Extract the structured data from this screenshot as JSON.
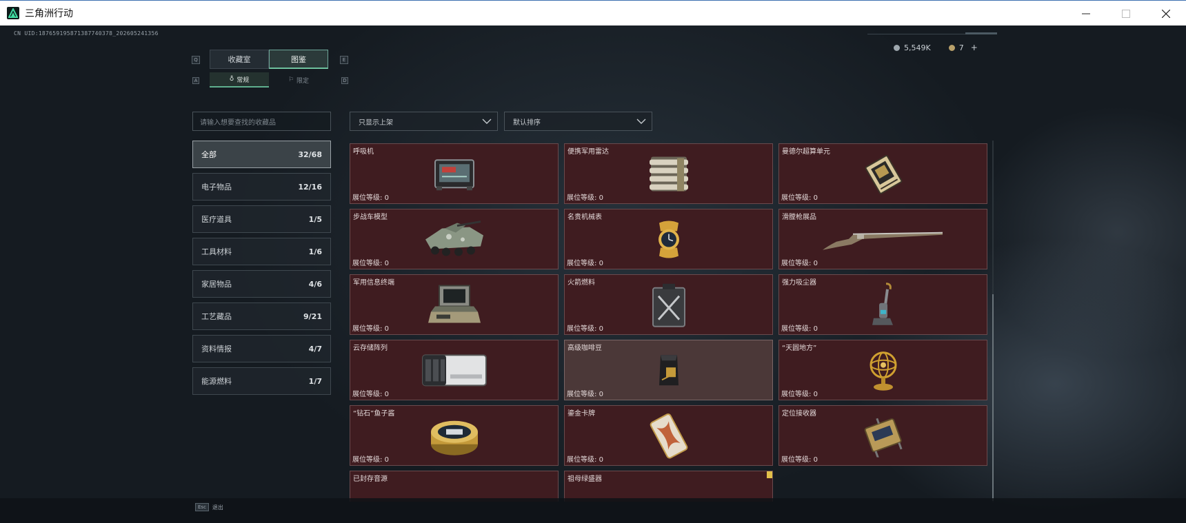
{
  "window": {
    "title": "三角洲行动"
  },
  "header": {
    "uid": "CN UID:18765919587138774037​8_202605241356",
    "silver": "5,549K",
    "gold": "7",
    "add": "+"
  },
  "keys": {
    "q": "Q",
    "e": "E",
    "a": "A",
    "d": "D",
    "esc": "Esc"
  },
  "tabs": {
    "main": [
      {
        "label": "收藏室"
      },
      {
        "label": "图鉴"
      }
    ],
    "sub": [
      {
        "label": "常规"
      },
      {
        "label": "限定"
      }
    ]
  },
  "search": {
    "placeholder": "请输入想要查找的收藏品"
  },
  "filters": {
    "show": "只显示上架",
    "sort": "默认排序"
  },
  "categories": [
    {
      "name": "全部",
      "count": "32/68"
    },
    {
      "name": "电子物品",
      "count": "12/16"
    },
    {
      "name": "医疗道具",
      "count": "1/5"
    },
    {
      "name": "工具材料",
      "count": "1/6"
    },
    {
      "name": "家居物品",
      "count": "4/6"
    },
    {
      "name": "工艺藏品",
      "count": "9/21"
    },
    {
      "name": "资料情报",
      "count": "4/7"
    },
    {
      "name": "能源燃料",
      "count": "1/7"
    }
  ],
  "level_label": "展位等级:",
  "items": [
    {
      "name": "呼吸机",
      "level": "0",
      "icon": "ventilator-icon"
    },
    {
      "name": "便携军用雷达",
      "level": "0",
      "icon": "radar-icon"
    },
    {
      "name": "曼德尔超算单元",
      "level": "0",
      "icon": "computing-unit-icon"
    },
    {
      "name": "步战车模型",
      "level": "0",
      "icon": "ifv-model-icon"
    },
    {
      "name": "名贵机械表",
      "level": "0",
      "icon": "watch-icon"
    },
    {
      "name": "滑膛枪展品",
      "level": "0",
      "icon": "musket-icon"
    },
    {
      "name": "军用信息终端",
      "level": "0",
      "icon": "terminal-icon"
    },
    {
      "name": "火箭燃料",
      "level": "0",
      "icon": "fuel-icon"
    },
    {
      "name": "强力吸尘器",
      "level": "0",
      "icon": "vacuum-icon"
    },
    {
      "name": "云存储阵列",
      "level": "0",
      "icon": "storage-array-icon"
    },
    {
      "name": "高级咖啡豆",
      "level": "0",
      "icon": "coffee-bag-icon"
    },
    {
      "name": "“天圆地方”",
      "level": "0",
      "icon": "armillary-icon"
    },
    {
      "name": "“钻石”鱼子酱",
      "level": "0",
      "icon": "caviar-icon"
    },
    {
      "name": "鎏金卡牌",
      "level": "0",
      "icon": "card-icon"
    },
    {
      "name": "定位接收器",
      "level": "0",
      "icon": "receiver-icon"
    },
    {
      "name": "已封存音源",
      "level": "",
      "icon": ""
    },
    {
      "name": "祖母绿盛器",
      "level": "",
      "icon": ""
    }
  ],
  "footer": {
    "back": "退出"
  }
}
